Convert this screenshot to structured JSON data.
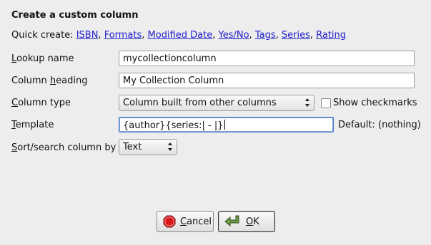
{
  "dialog": {
    "heading": "Create a custom column",
    "quick_create": {
      "prefix": "Quick create:",
      "links": [
        "ISBN",
        "Formats",
        "Modified Date",
        "Yes/No",
        "Tags",
        "Series",
        "Rating"
      ]
    },
    "lookup_name": {
      "label_pre": "",
      "label_mnemonic": "L",
      "label_post": "ookup name",
      "value": "mycollectioncolumn"
    },
    "column_heading": {
      "label_pre": "Column ",
      "label_mnemonic": "h",
      "label_post": "eading",
      "value": "My Collection Column"
    },
    "column_type": {
      "label_pre": "",
      "label_mnemonic": "C",
      "label_post": "olumn type",
      "selected": "Column built from other columns"
    },
    "show_checkmarks": {
      "label": "Show checkmarks",
      "checked": false
    },
    "template": {
      "label_pre": "",
      "label_mnemonic": "T",
      "label_post": "emplate",
      "value": "{author}{series:| - |}",
      "default_text": "Default: (nothing)"
    },
    "sort_search": {
      "label_pre": "",
      "label_mnemonic": "S",
      "label_post": "ort/search column by",
      "selected": "Text"
    },
    "buttons": {
      "cancel": {
        "mnemonic": "C",
        "rest": "ancel",
        "icon": "stop-icon"
      },
      "ok": {
        "mnemonic": "O",
        "rest": "K",
        "icon": "ok-arrow-icon"
      }
    },
    "colors": {
      "link": "#2020d0",
      "focus": "#4a78c4",
      "stop_red": "#d81818",
      "ok_green": "#5a8a3a"
    }
  }
}
